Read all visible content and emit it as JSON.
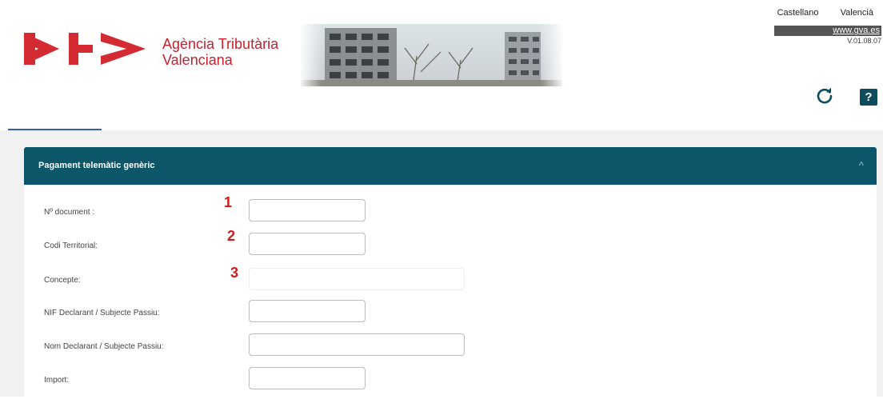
{
  "header": {
    "brand_line1": "Agència Tributària",
    "brand_line2": "Valenciana",
    "languages": [
      "Castellano",
      "Valencià"
    ],
    "gva_link": "www.gva.es",
    "version": "V.01.08.07",
    "help_label": "?"
  },
  "panel": {
    "title": "Pagament telemàtic genèric",
    "fields": [
      {
        "label": "Nº document :",
        "marker": "1",
        "value": ""
      },
      {
        "label": "Codi Territorial:",
        "marker": "2",
        "value": ""
      },
      {
        "label": "Concepte:",
        "marker": "3",
        "value": ""
      },
      {
        "label": "NIF Declarant / Subjecte Passiu:",
        "marker": "",
        "value": ""
      },
      {
        "label": "Nom Declarant / Subjecte Passiu:",
        "marker": "",
        "value": ""
      },
      {
        "label": "Import:",
        "marker": "",
        "value": ""
      }
    ]
  },
  "colors": {
    "brand_red": "#c8202f",
    "panel_header": "#0b5769",
    "help_bg": "#0f4c5c",
    "marker_red": "#d01919"
  }
}
